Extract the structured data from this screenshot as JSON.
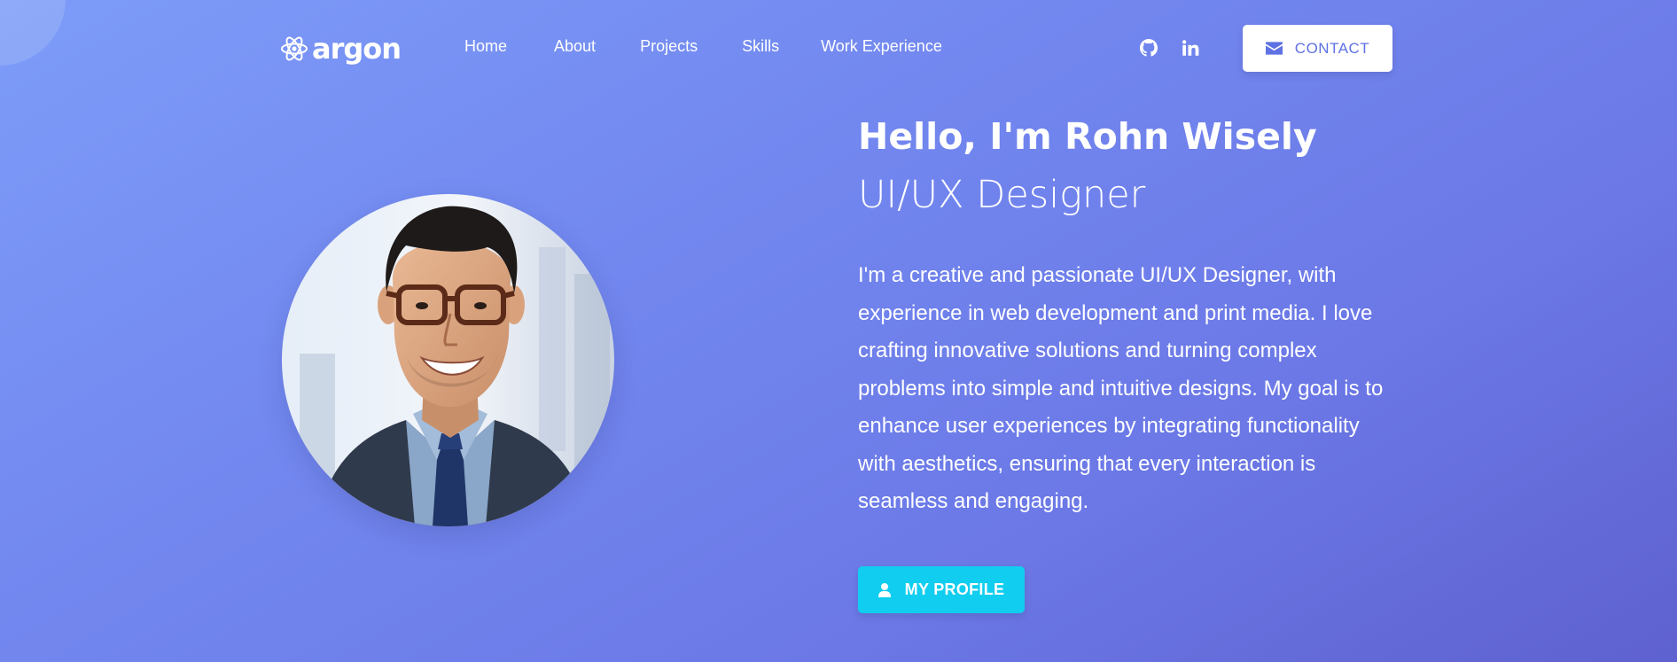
{
  "brand": {
    "name": "argon",
    "icon": "atom-icon"
  },
  "nav": {
    "items": [
      {
        "label": "Home"
      },
      {
        "label": "About"
      },
      {
        "label": "Projects"
      },
      {
        "label": "Skills"
      },
      {
        "label": "Work Experience"
      }
    ],
    "social": [
      {
        "icon": "github-icon"
      },
      {
        "icon": "linkedin-icon"
      }
    ],
    "contact_label": "CONTACT",
    "contact_icon": "envelope-icon"
  },
  "hero": {
    "title": "Hello, I'm Rohn Wisely",
    "subtitle": "UI/UX Designer",
    "description": "I'm a creative and passionate UI/UX Designer, with experience in web development and print media. I love crafting innovative solutions and turning complex problems into simple and intuitive designs. My goal is to enhance user experiences by integrating functionality with aesthetics, ensuring that every interaction is seamless and engaging.",
    "button_label": "MY PROFILE",
    "button_icon": "user-icon"
  },
  "colors": {
    "primary": "#5e72e4",
    "info": "#11cdef",
    "bg_start": "#7d9cf8",
    "bg_end": "#5e61cf"
  }
}
